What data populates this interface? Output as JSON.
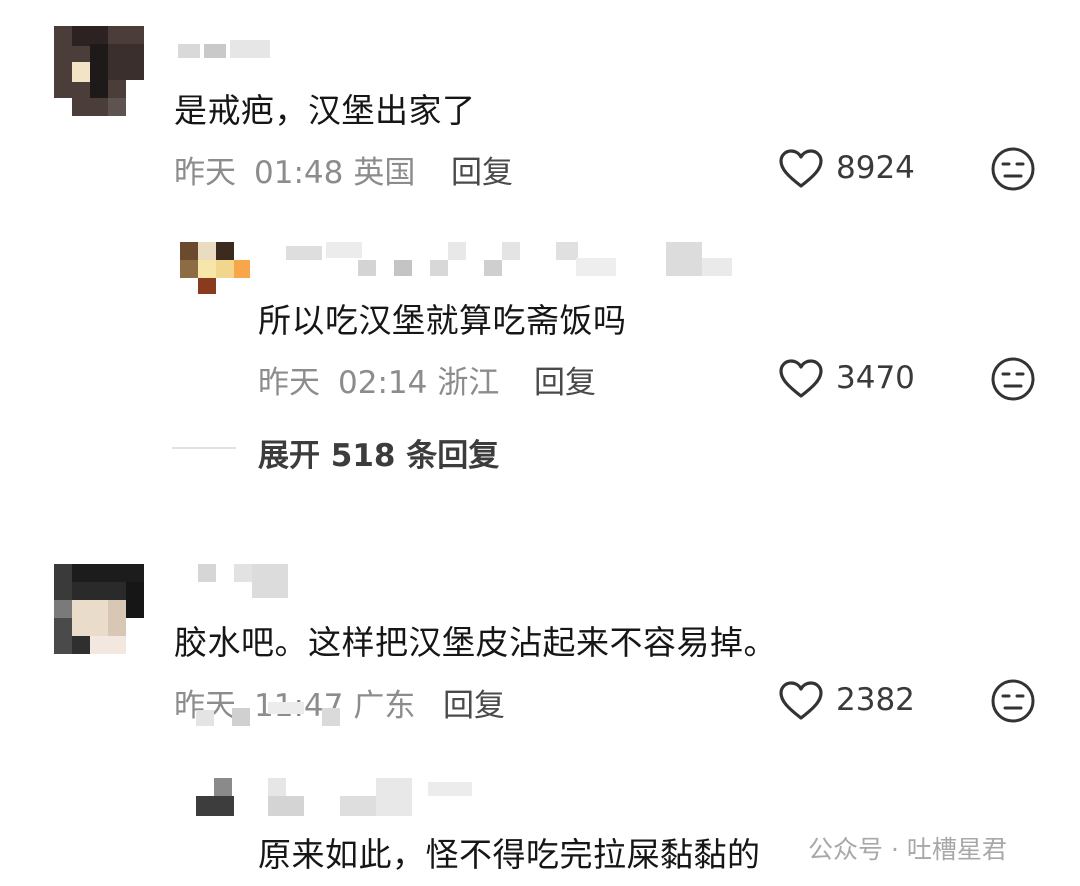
{
  "comments": [
    {
      "text": "是戒疤，汉堡出家了",
      "date": "昨天",
      "time": "01:48",
      "location": "英国",
      "reply_label": "回复",
      "likes": "8924",
      "replies": [
        {
          "text": "所以吃汉堡就算吃斋饭吗",
          "date": "昨天",
          "time": "02:14",
          "location": "浙江",
          "reply_label": "回复",
          "likes": "3470"
        }
      ],
      "expand_label": "展开 518 条回复"
    },
    {
      "text": "胶水吧。这样把汉堡皮沾起来不容易掉。",
      "date": "昨天",
      "time": "11:47",
      "location": "广东",
      "reply_label": "回复",
      "likes": "2382",
      "replies": [
        {
          "text": "原来如此，怪不得吃完拉屎黏黏的"
        }
      ]
    }
  ],
  "watermark": "公众号 · 吐槽星君",
  "icons": {
    "like": "heart-outline-icon",
    "dislike": "meh-face-icon"
  },
  "colors": {
    "text": "#161616",
    "meta": "#8c8c8c",
    "icon": "#333333"
  }
}
